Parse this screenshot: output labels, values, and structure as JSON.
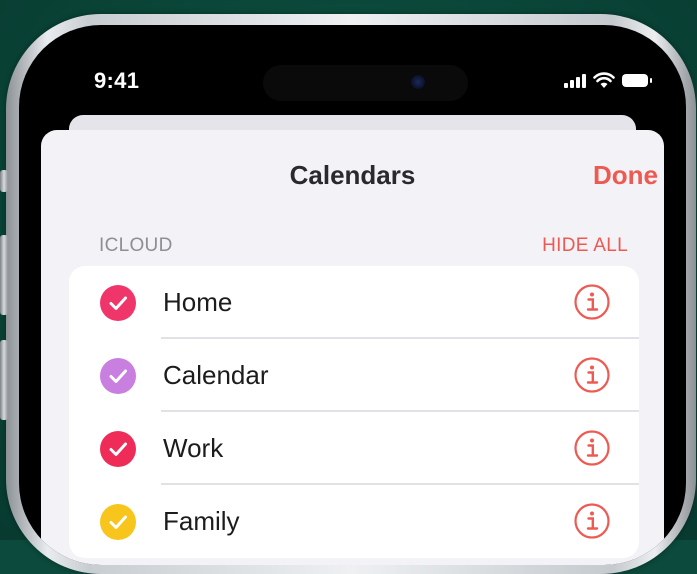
{
  "status_bar": {
    "time": "9:41"
  },
  "sheet": {
    "title": "Calendars",
    "done_label": "Done",
    "section_label": "ICLOUD",
    "hide_all_label": "HIDE ALL"
  },
  "calendars": [
    {
      "name": "Home",
      "color": "#f0356a",
      "checked": true
    },
    {
      "name": "Calendar",
      "color": "#c87fe0",
      "checked": true
    },
    {
      "name": "Work",
      "color": "#ee2c57",
      "checked": true
    },
    {
      "name": "Family",
      "color": "#f8c51c",
      "checked": true
    }
  ],
  "colors": {
    "accent": "#ee5a52",
    "background": "#0b4a3c"
  }
}
